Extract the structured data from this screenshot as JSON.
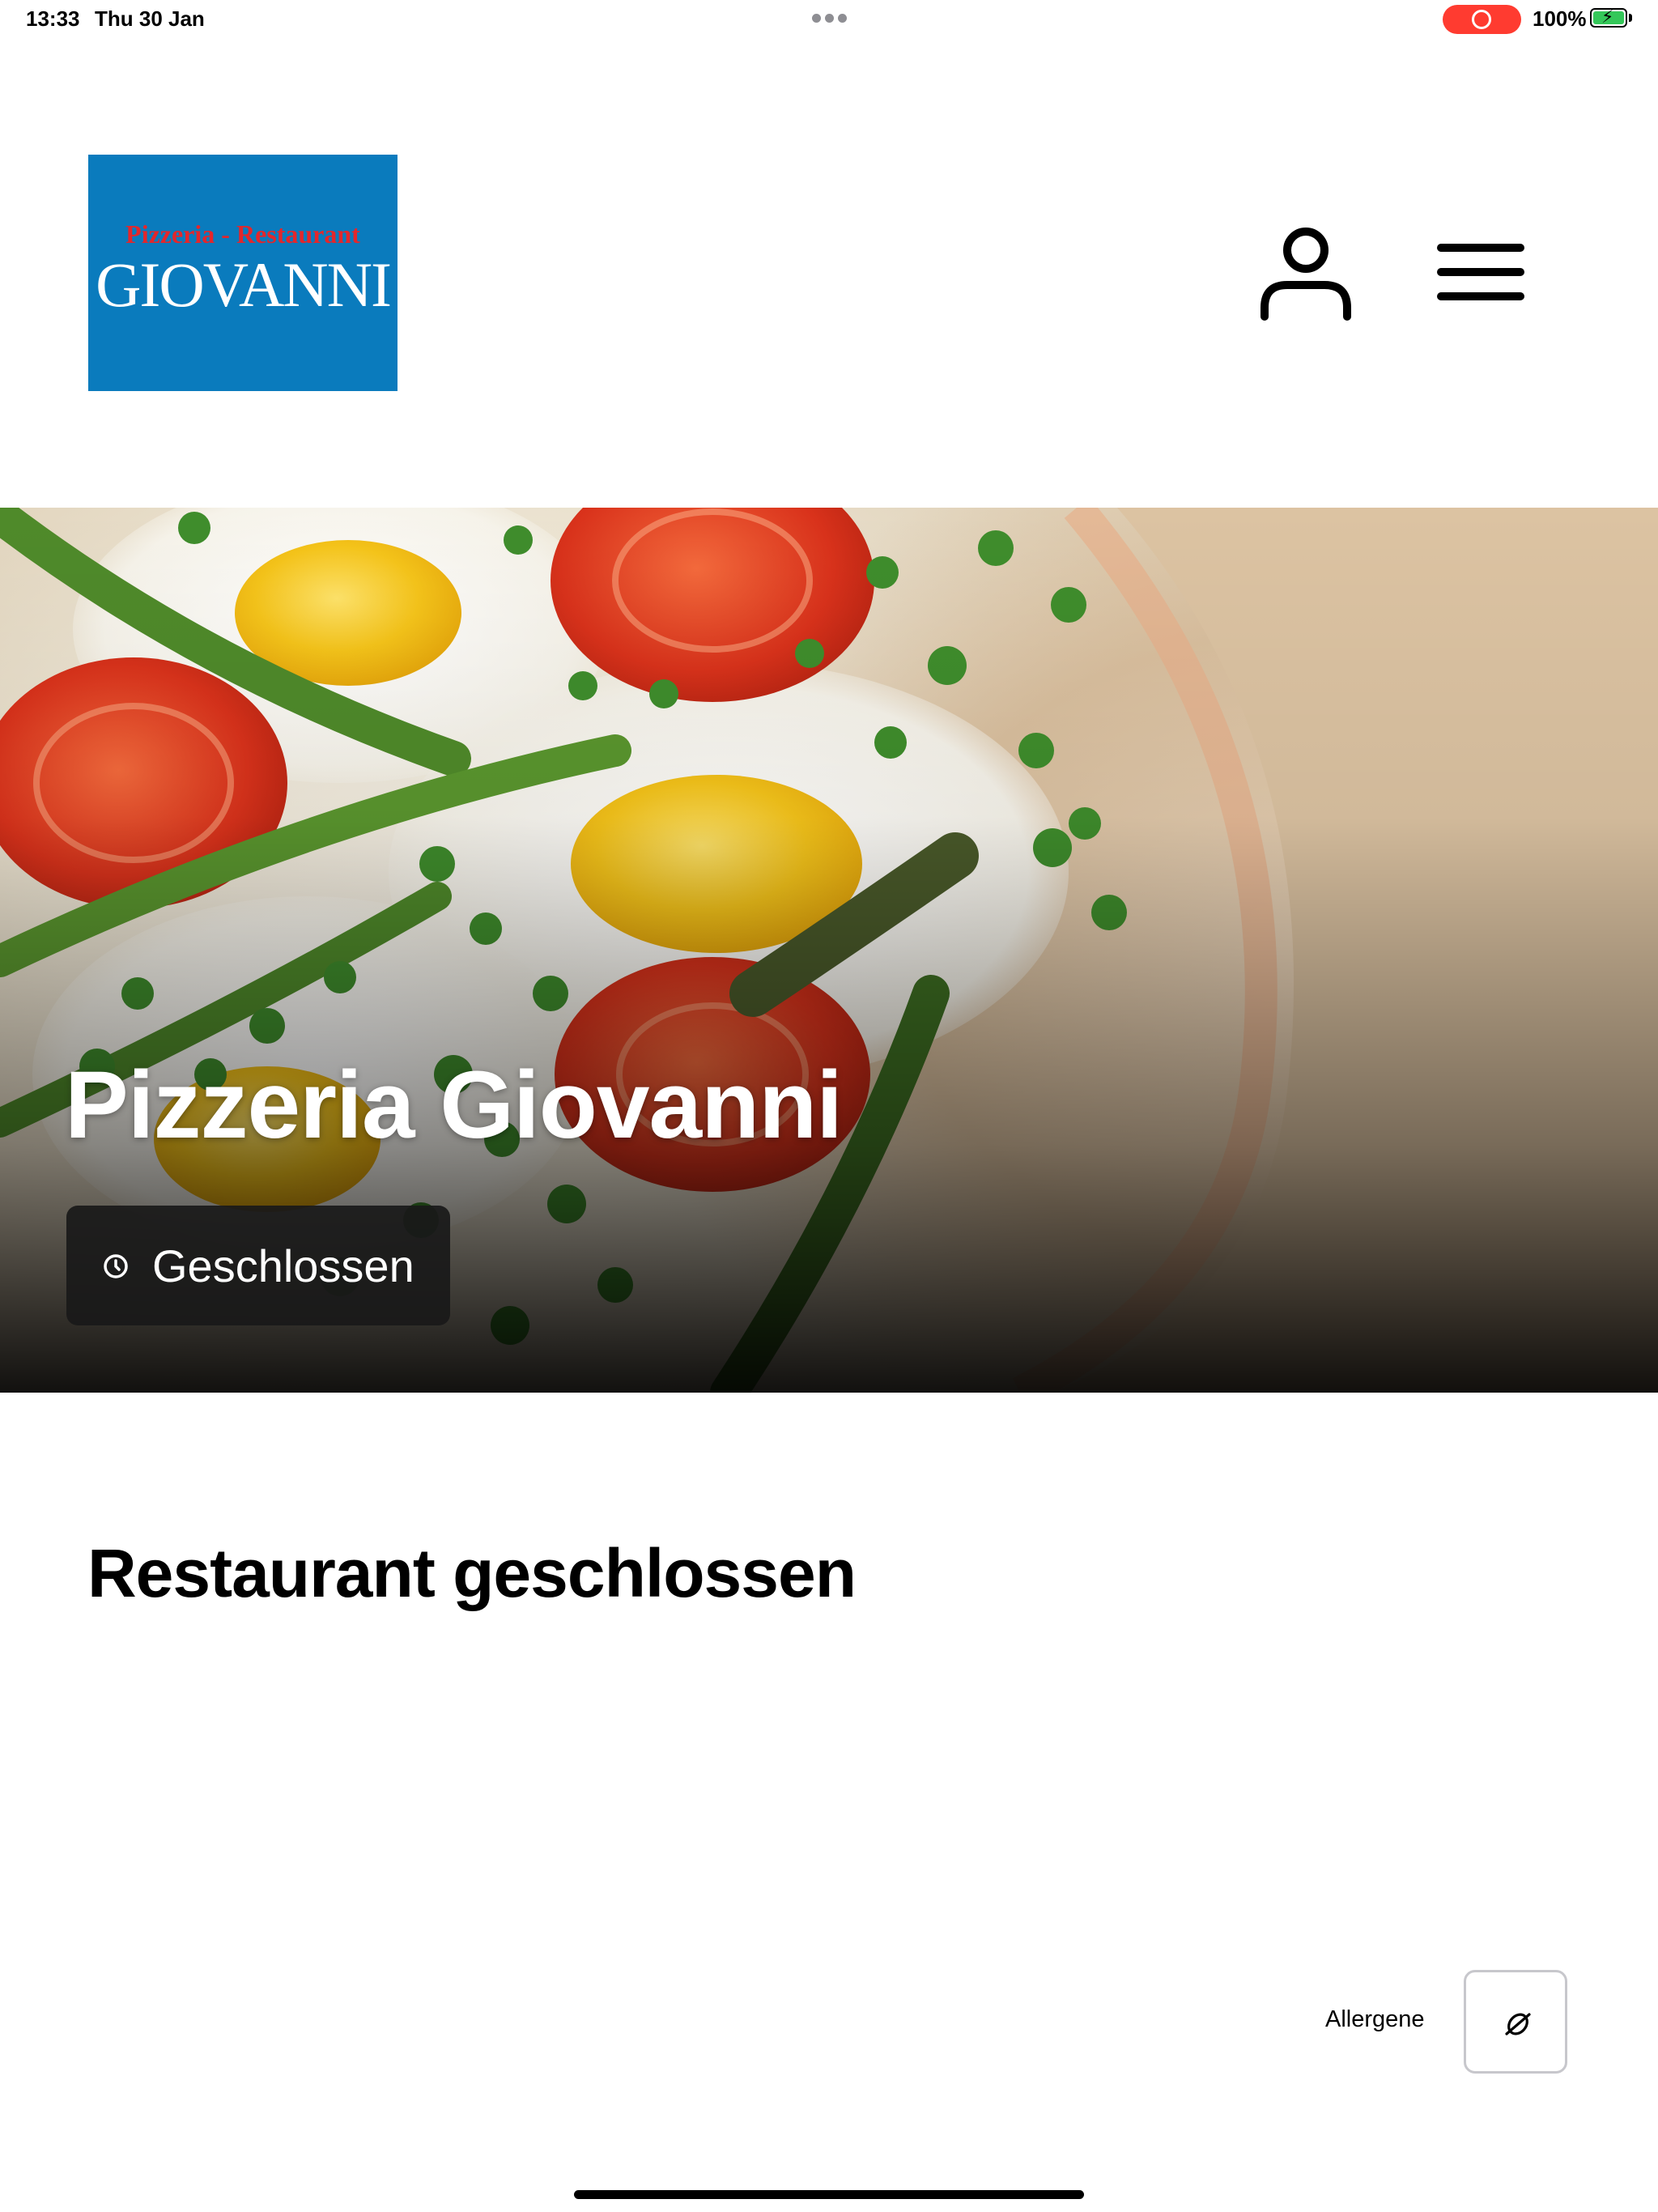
{
  "status_bar": {
    "time": "13:33",
    "date": "Thu 30 Jan",
    "battery": "100%",
    "recording_color": "#ff3b30",
    "battery_color": "#34c759"
  },
  "header": {
    "logo": {
      "top_text": "Pizzeria - Restaurant",
      "main_text": "GIOVANNI",
      "background": "#0a7bbd"
    },
    "icons": [
      "user-icon",
      "menu-icon"
    ]
  },
  "hero": {
    "title": "Pizzeria Giovanni",
    "status": "Geschlossen",
    "status_icon": "clock-icon"
  },
  "main": {
    "title": "Restaurant geschlossen"
  },
  "allergens": {
    "label": "Allergene",
    "icon": "no-allergen-icon"
  }
}
